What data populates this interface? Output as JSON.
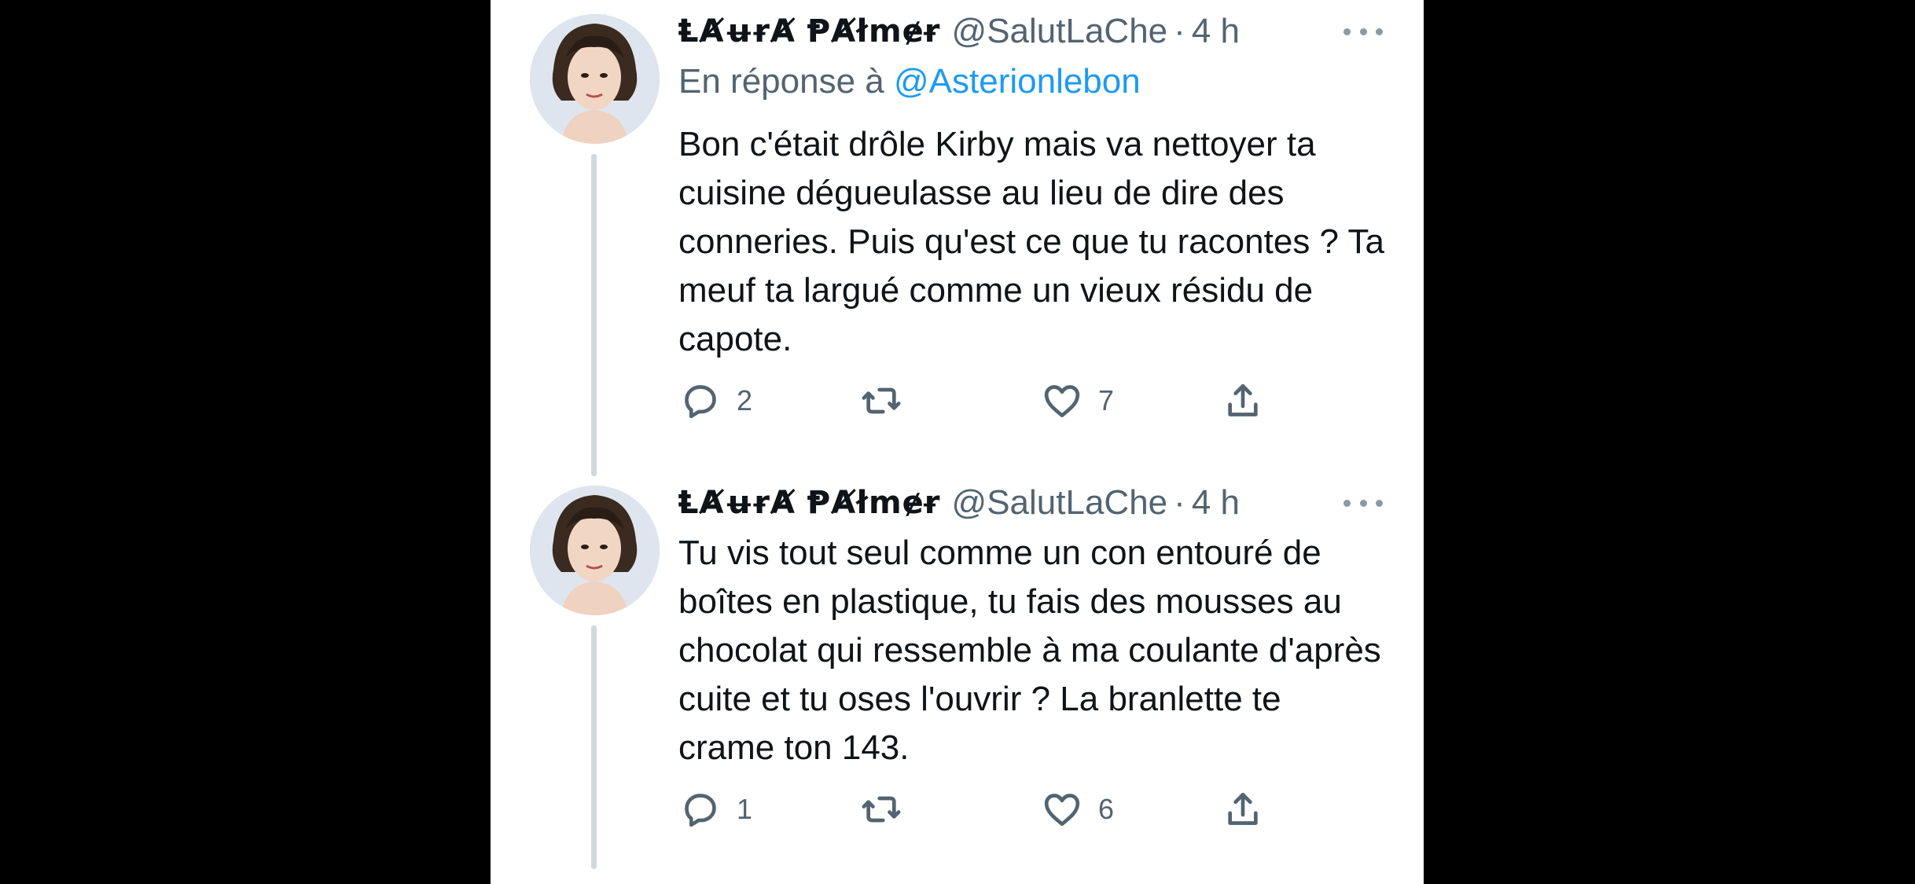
{
  "tweets": [
    {
      "display_name": "ⱠȺʉɍȺ ⱣȺłmɇɍ",
      "handle": "@SalutLaChe",
      "separator": "·",
      "time": "4 h",
      "reply_prefix": "En réponse à",
      "reply_mention": "@Asterionlebon",
      "text": "Bon c'était drôle Kirby mais va nettoyer ta cuisine dégueulasse au lieu de dire des conneries. Puis qu'est ce que tu racontes ? Ta meuf ta largué comme un vieux résidu de capote.",
      "replies": "2",
      "likes": "7"
    },
    {
      "display_name": "ⱠȺʉɍȺ ⱣȺłmɇɍ",
      "handle": "@SalutLaChe",
      "separator": "·",
      "time": "4 h",
      "text": "Tu vis tout seul comme un con entouré de boîtes en plastique, tu fais des mousses au chocolat qui ressemble à ma coulante d'après cuite et tu oses l'ouvrir ? La branlette te crame ton 143.",
      "replies": "1",
      "likes": "6"
    }
  ],
  "icons": {
    "reply": "speech-bubble-icon",
    "retweet": "retweet-arrows-icon",
    "like": "heart-icon",
    "share": "share-upload-icon",
    "more": "more-dots-icon"
  },
  "colors": {
    "background": "#000000",
    "card": "#ffffff",
    "text": "#0f1419",
    "secondary": "#536471",
    "link": "#1d9bf0",
    "thread_line": "#cfd9de"
  }
}
